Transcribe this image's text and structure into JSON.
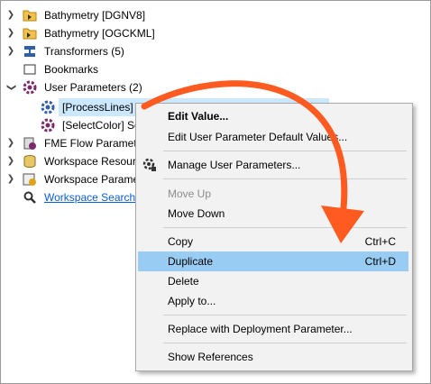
{
  "tree": {
    "items": [
      {
        "label": "Bathymetry [DGNV8]",
        "icon": "folder-reader-icon"
      },
      {
        "label": "Bathymetry [OGCKML]",
        "icon": "folder-writer-icon"
      },
      {
        "label": "Transformers (5)",
        "icon": "transformers-icon"
      },
      {
        "label": "Bookmarks",
        "icon": "bookmark-icon"
      },
      {
        "label": "User Parameters (2)",
        "icon": "gear-icon"
      },
      {
        "label": "[ProcessLines] D",
        "icon": "user-parameter-icon"
      },
      {
        "label": "[SelectColor] Se",
        "icon": "user-parameter-icon"
      },
      {
        "label": "FME Flow Paramete",
        "icon": "server-gear-icon"
      },
      {
        "label": "Workspace Resourc",
        "icon": "database-icon"
      },
      {
        "label": "Workspace Paramet",
        "icon": "settings-gear-icon"
      },
      {
        "label": "Workspace Search...",
        "icon": "search-icon"
      }
    ]
  },
  "menu": {
    "edit_value": "Edit Value...",
    "edit_defaults": "Edit User Parameter Default Values...",
    "manage": "Manage User Parameters...",
    "move_up": "Move Up",
    "move_down": "Move Down",
    "copy": "Copy",
    "copy_shortcut": "Ctrl+C",
    "duplicate": "Duplicate",
    "duplicate_shortcut": "Ctrl+D",
    "delete": "Delete",
    "apply_to": "Apply to...",
    "replace": "Replace with Deployment Parameter...",
    "show_refs": "Show References"
  },
  "colors": {
    "annotation_arrow": "#ff5a1f",
    "highlight": "#99ccf3",
    "selection": "#cce8ff"
  }
}
